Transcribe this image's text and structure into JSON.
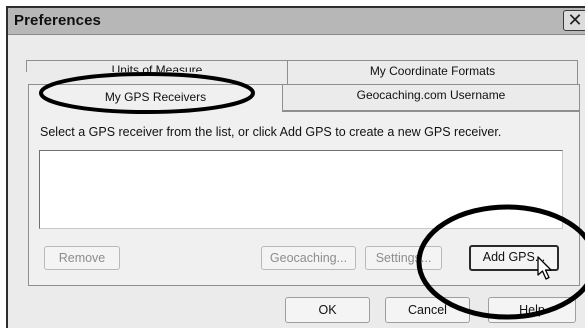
{
  "window": {
    "title": "Preferences"
  },
  "tabs": {
    "units_of_measure": "Units of Measure",
    "my_coordinate_formats": "My Coordinate Formats",
    "my_gps_receivers": "My GPS Receivers",
    "geocaching_username": "Geocaching.com Username"
  },
  "panel": {
    "instruction": "Select a GPS receiver from the list, or click Add GPS to create a new GPS receiver.",
    "receivers": []
  },
  "buttons": {
    "remove": "Remove",
    "geocaching": "Geocaching...",
    "settings": "Settings...",
    "add_gps": "Add GPS...",
    "ok": "OK",
    "cancel": "Cancel",
    "help": "Help"
  },
  "colors": {
    "annotation": "#000000",
    "dialog_bg": "#ebebeb",
    "titlebar": "#b7b7b7"
  }
}
